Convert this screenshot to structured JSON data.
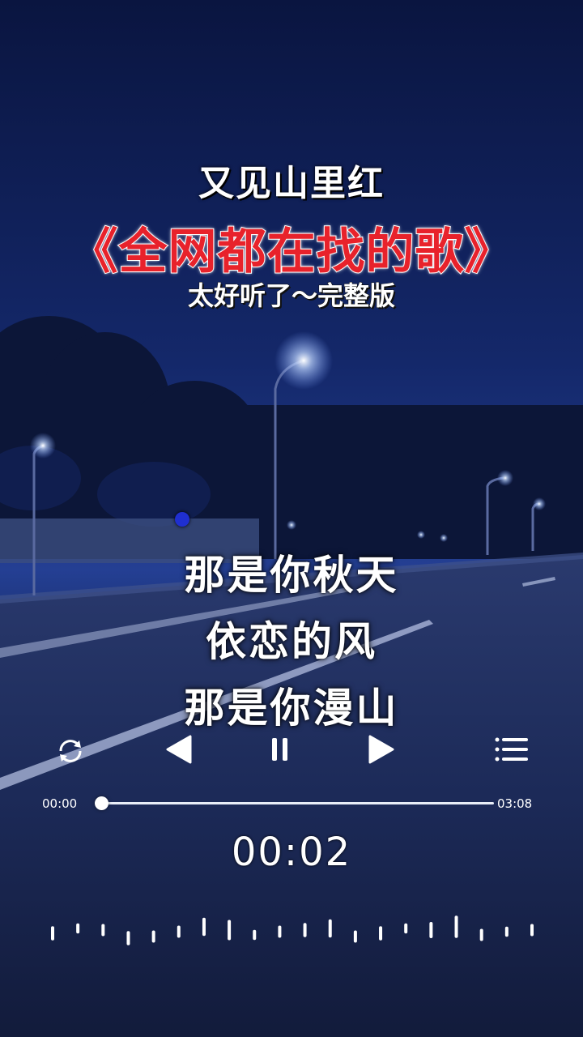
{
  "header": {
    "song_title": "又见山里红",
    "headline": "《全网都在找的歌》",
    "subtitle": "太好听了～完整版"
  },
  "lyrics": [
    "那是你秋天",
    "依恋的风",
    "那是你漫山"
  ],
  "player": {
    "controls": {
      "repeat_icon": "repeat-icon",
      "prev_icon": "previous-icon",
      "pause_icon": "pause-icon",
      "next_icon": "next-icon",
      "list_icon": "playlist-icon"
    },
    "elapsed_label": "00:00",
    "duration_label": "03:08",
    "progress_fraction": 0.01,
    "current_time": "00:02"
  },
  "colors": {
    "headline_red": "#e8222b",
    "sky_top": "#0d1b4a",
    "sky_mid": "#1a2f7a",
    "road": "#1c2d5c"
  },
  "waveform": {
    "bar_heights": [
      0.35,
      0.25,
      0.3,
      0.35,
      0.3,
      0.3,
      0.45,
      0.5,
      0.25,
      0.3,
      0.35,
      0.45,
      0.3,
      0.35,
      0.25,
      0.4,
      0.55,
      0.3,
      0.25,
      0.3
    ]
  }
}
